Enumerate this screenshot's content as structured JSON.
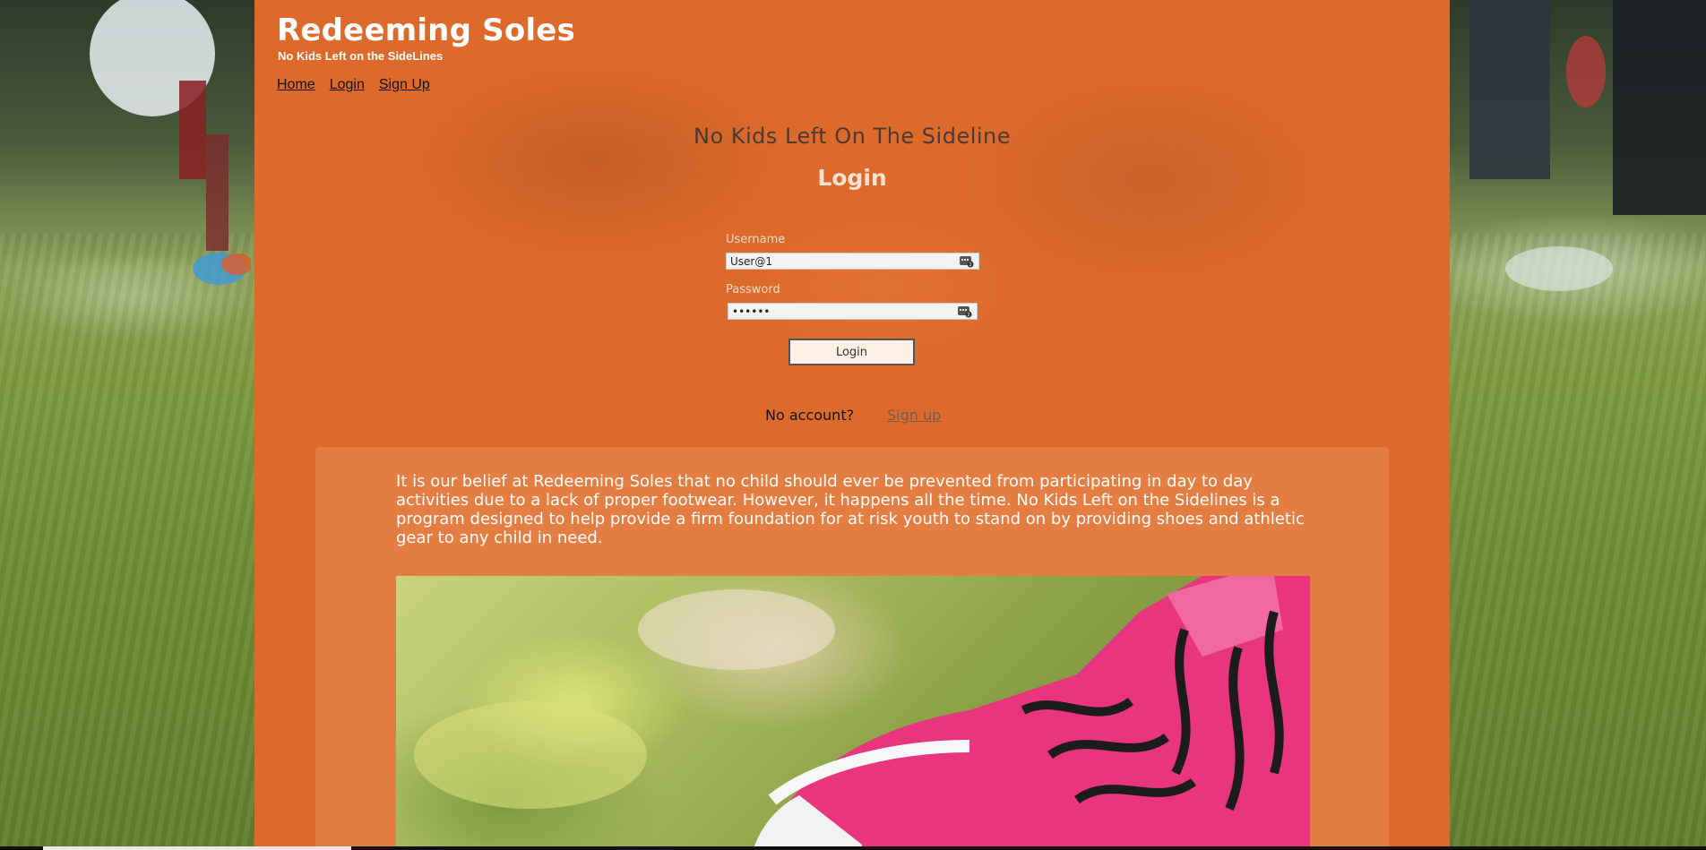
{
  "site": {
    "brand": "Redeeming Soles",
    "tagline": "No Kids Left on the SideLines"
  },
  "nav": {
    "items": [
      {
        "label": "Home"
      },
      {
        "label": "Login"
      },
      {
        "label": "Sign Up"
      }
    ]
  },
  "main": {
    "hero_title": "No Kids Left On The Sideline",
    "login_title": "Login"
  },
  "login_form": {
    "username_label": "Username",
    "username_value": "User@1",
    "password_label": "Password",
    "password_value": "••••••",
    "submit_label": "Login"
  },
  "signup_prompt": {
    "text": "No account?",
    "link_label": "Sign up"
  },
  "info": {
    "paragraph": "It is our belief at Redeeming Soles that no child should ever be prevented from participating in day to day activities due to a lack of proper footwear. However, it happens all the time. No Kids Left on the Sidelines is a program designed to help provide a firm foundation for at risk youth to stand on by providing shoes and athletic gear to any child in need."
  },
  "colors": {
    "panel": "#dd6a2a",
    "shoe": "#e8357e",
    "laces": "#1c1c1c"
  },
  "icons": {
    "field_icon": "password-manager-key-icon"
  }
}
